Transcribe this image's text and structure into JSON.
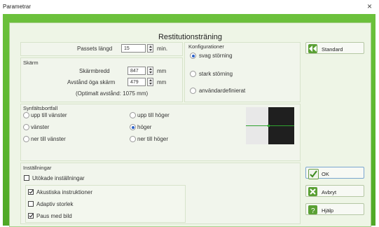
{
  "window": {
    "title": "Parametrar",
    "close_glyph": "×"
  },
  "heading": "Restitutionsträning",
  "session": {
    "label": "Passets längd",
    "value": "15",
    "unit": "min."
  },
  "screen": {
    "group_label": "Skärm",
    "width_label": "Skärmbredd",
    "width_value": "847",
    "width_unit": "mm",
    "distance_label": "Avstånd öga skärm",
    "distance_value": "479",
    "distance_unit": "mm",
    "optimal_note": "(Optimalt avstånd: 1075 mm)"
  },
  "configurations": {
    "group_label": "Konfigurationer",
    "options": [
      {
        "label": "svag störning",
        "selected": true
      },
      {
        "label": "stark störning",
        "selected": false
      },
      {
        "label": "användardefinierat",
        "selected": false
      }
    ]
  },
  "field_loss": {
    "group_label": "Synfältsbortfall",
    "options": [
      {
        "label": "upp till vänster",
        "selected": false
      },
      {
        "label": "vänster",
        "selected": false
      },
      {
        "label": "ner till vänster",
        "selected": false
      },
      {
        "label": "upp till höger",
        "selected": false
      },
      {
        "label": "höger",
        "selected": true
      },
      {
        "label": "ner till höger",
        "selected": false
      }
    ]
  },
  "settings": {
    "group_label": "Inställningar",
    "extended_label": "Utökade inställningar",
    "extended_checked": false,
    "checkboxes": [
      {
        "label": "Akustiska instruktioner",
        "checked": true
      },
      {
        "label": "Adaptiv storlek",
        "checked": false
      },
      {
        "label": "Paus med bild",
        "checked": true
      }
    ]
  },
  "buttons": {
    "standard": "Standard",
    "ok": "OK",
    "cancel": "Avbryt",
    "help": "Hjälp"
  },
  "icons": {
    "standard": "rewind-icon",
    "ok": "checkmark-icon",
    "cancel": "x-icon",
    "help": "question-icon"
  },
  "colors": {
    "frame_green": "#5ab52d",
    "panel_bg": "#f1f5ec",
    "preview_dark": "#1f1f1f",
    "preview_line": "#2fa22f"
  }
}
